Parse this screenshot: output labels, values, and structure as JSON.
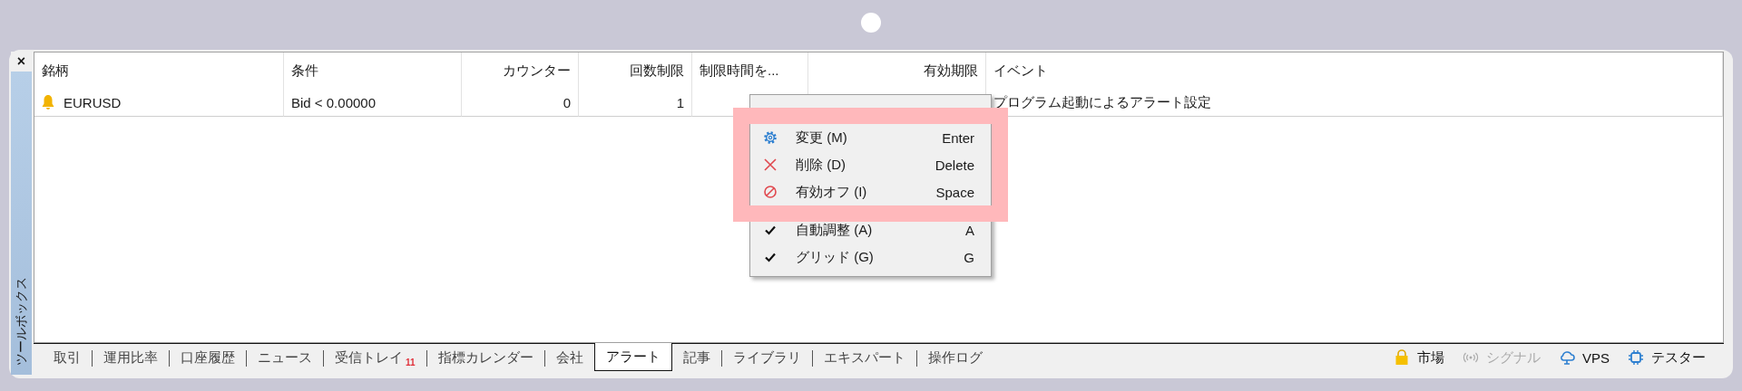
{
  "sidebar": {
    "close": "×",
    "title": "ツールボックス"
  },
  "table": {
    "columns": [
      {
        "label": "銘柄"
      },
      {
        "label": "条件"
      },
      {
        "label": "カウンター"
      },
      {
        "label": "回数制限"
      },
      {
        "label": "制限時間を..."
      },
      {
        "label": "有効期限"
      },
      {
        "label": "イベント"
      }
    ],
    "rows": [
      {
        "enabled": true,
        "cells": [
          "EURUSD",
          "Bid < 0.00000",
          "0",
          "1",
          null,
          null,
          "プログラム起動によるアラート設定"
        ]
      }
    ]
  },
  "context_menu": {
    "items": [
      {
        "kind": "action",
        "label": "変更 (M)",
        "shortcut": "Enter",
        "highlighted": true
      },
      {
        "kind": "action",
        "label": "削除 (D)",
        "shortcut": "Delete",
        "highlighted": true
      },
      {
        "kind": "action",
        "label": "有効オフ (I)",
        "shortcut": "Space",
        "highlighted": true
      },
      {
        "kind": "check",
        "label": "自動調整 (A)",
        "shortcut": "A",
        "checked": true,
        "highlighted": false
      },
      {
        "kind": "check",
        "label": "グリッド (G)",
        "shortcut": "G",
        "checked": true,
        "highlighted": false
      }
    ]
  },
  "tabs": [
    {
      "label": "取引",
      "selected": false
    },
    {
      "label": "運用比率",
      "selected": false
    },
    {
      "label": "口座履歴",
      "selected": false
    },
    {
      "label": "ニュース",
      "selected": false
    },
    {
      "label": "受信トレイ",
      "badge": "11",
      "selected": false
    },
    {
      "label": "指標カレンダー",
      "selected": false
    },
    {
      "label": "会社",
      "selected": false
    },
    {
      "label": "アラート",
      "selected": true
    },
    {
      "label": "記事",
      "selected": false
    },
    {
      "label": "ライブラリ",
      "selected": false
    },
    {
      "label": "エキスパート",
      "selected": false
    },
    {
      "label": "操作ログ",
      "selected": false
    }
  ],
  "status_items": [
    {
      "label": "市場",
      "disabled": false
    },
    {
      "label": "シグナル",
      "disabled": true
    },
    {
      "label": "VPS",
      "disabled": false
    },
    {
      "label": "テスター",
      "disabled": false
    }
  ]
}
